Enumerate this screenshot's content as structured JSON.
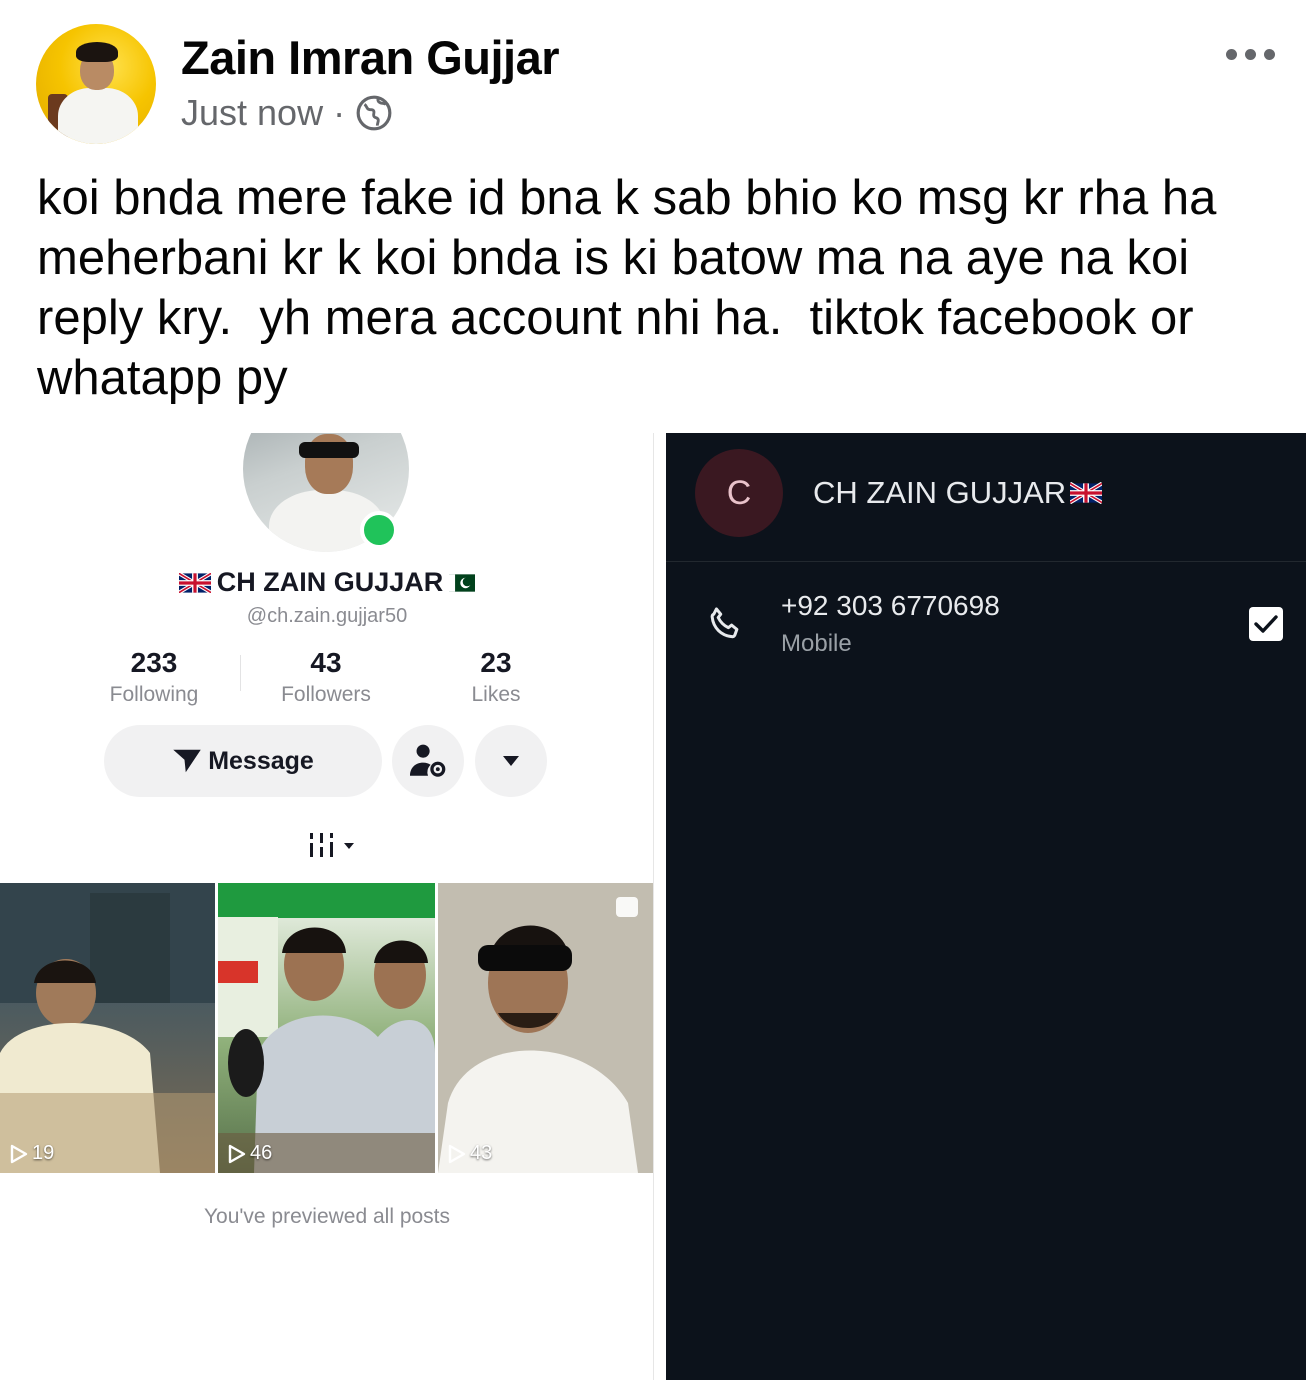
{
  "post": {
    "author": "Zain Imran Gujjar",
    "timestamp": "Just now",
    "separator": "·",
    "privacy_icon": "globe-icon",
    "more_icon": "more-horizontal-icon",
    "text": "koi bnda mere fake id bna k sab bhio ko msg kr rha ha meherbani kr k koi bnda is ki batow ma na aye na koi reply kry.  yh mera account nhi ha.  tiktok facebook or whatapp py"
  },
  "tiktok_profile": {
    "name": "CH ZAIN GUJJAR",
    "handle": "@ch.zain.gujjar50",
    "stats": [
      {
        "value": "233",
        "label": "Following"
      },
      {
        "value": "43",
        "label": "Followers"
      },
      {
        "value": "23",
        "label": "Likes"
      }
    ],
    "message_button": "Message",
    "videos": [
      {
        "views": "19"
      },
      {
        "views": "46"
      },
      {
        "views": "43"
      }
    ],
    "footer": "You've previewed all posts",
    "colors": {
      "online": "#20c35a",
      "text": "#161823",
      "muted": "#8a8b91"
    }
  },
  "contact": {
    "initial": "C",
    "name": "CH ZAIN GUJJAR",
    "phone": "+92 303 6770698",
    "phone_type": "Mobile",
    "colors": {
      "background": "#0c121b",
      "avatar": "#3a1821"
    }
  }
}
